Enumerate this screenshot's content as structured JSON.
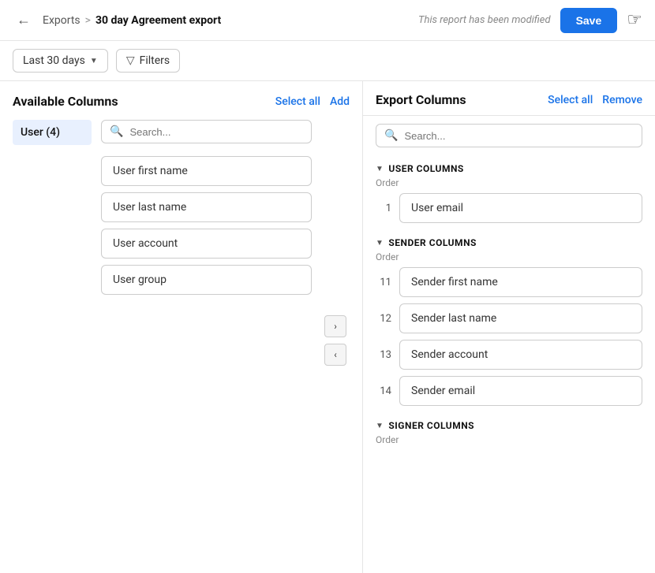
{
  "header": {
    "back_label": "←",
    "breadcrumb_parent": "Exports",
    "breadcrumb_sep": ">",
    "breadcrumb_current": "30 day Agreement export",
    "modified_text": "This report has been modified",
    "save_label": "Save"
  },
  "toolbar": {
    "date_label": "Last 30 days",
    "filter_label": "Filters"
  },
  "left_panel": {
    "title": "Available Columns",
    "select_all_label": "Select all",
    "add_label": "Add",
    "search_placeholder": "Search...",
    "categories": [
      {
        "label": "User (4)",
        "active": true
      }
    ],
    "columns": [
      {
        "label": "User first name"
      },
      {
        "label": "User last name"
      },
      {
        "label": "User account"
      },
      {
        "label": "User group"
      }
    ]
  },
  "right_panel": {
    "title": "Export Columns",
    "select_all_label": "Select all",
    "remove_label": "Remove",
    "search_placeholder": "Search...",
    "sections": [
      {
        "id": "user-columns",
        "label": "USER COLUMNS",
        "order_label": "Order",
        "items": [
          {
            "order": "1",
            "label": "User email"
          }
        ]
      },
      {
        "id": "sender-columns",
        "label": "SENDER COLUMNS",
        "order_label": "Order",
        "items": [
          {
            "order": "11",
            "label": "Sender first name"
          },
          {
            "order": "12",
            "label": "Sender last name"
          },
          {
            "order": "13",
            "label": "Sender account"
          },
          {
            "order": "14",
            "label": "Sender email"
          }
        ]
      },
      {
        "id": "signer-columns",
        "label": "SIGNER COLUMNS",
        "order_label": "Order",
        "items": []
      }
    ]
  },
  "transfer_btns": {
    "right_label": "›",
    "left_label": "‹"
  }
}
